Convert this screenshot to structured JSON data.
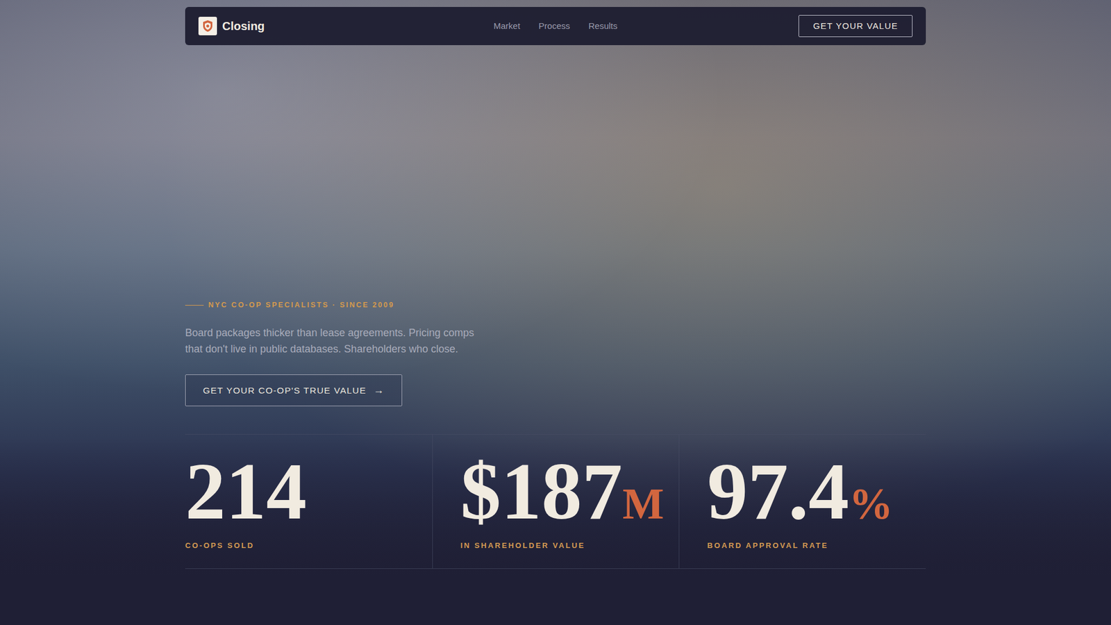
{
  "nav": {
    "brand": "Closing",
    "links": [
      "Market",
      "Process",
      "Results"
    ],
    "button": "GET YOUR VALUE"
  },
  "hero": {
    "eyebrow": "NYC CO-OP SPECIALISTS · SINCE 2009",
    "body": "Board packages thicker than lease agreements. Pricing comps that don't live in public databases. Shareholders who close.",
    "cta": {
      "label": "GET YOUR CO-OP'S TRUE VALUE",
      "arrow": "→"
    }
  },
  "stats": [
    {
      "value": "214",
      "suffix": "",
      "label": "CO-OPS SOLD"
    },
    {
      "value": "$187",
      "suffix": "M",
      "label": "IN SHAREHOLDER VALUE"
    },
    {
      "value": "97.4",
      "suffix": "%",
      "label": "BOARD APPROVAL RATE"
    }
  ]
}
